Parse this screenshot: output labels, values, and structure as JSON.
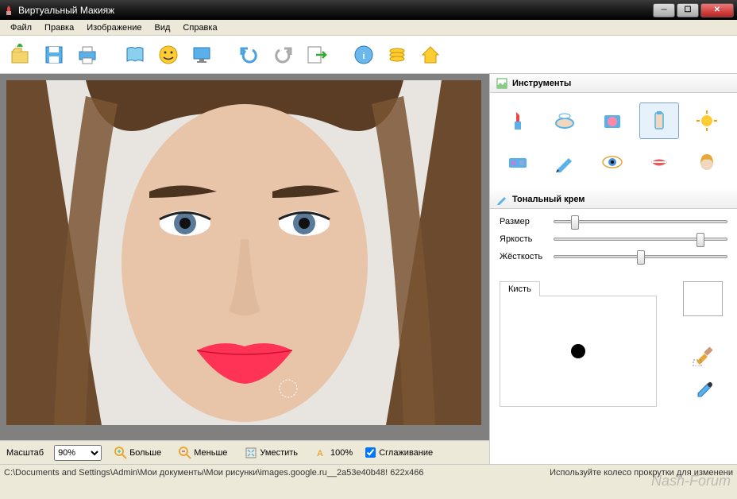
{
  "window": {
    "title": "Виртуальный Макияж"
  },
  "menu": {
    "file": "Файл",
    "edit": "Правка",
    "image": "Изображение",
    "view": "Вид",
    "help": "Справка"
  },
  "bottombar": {
    "scale_label": "Масштаб",
    "scale_value": "90%",
    "more": "Больше",
    "less": "Меньше",
    "fit": "Уместить",
    "hundred": "100%",
    "smoothing": "Сглаживание"
  },
  "panels": {
    "tools_title": "Инструменты",
    "tool_title": "Тональный крем"
  },
  "sliders": {
    "size": "Размер",
    "brightness": "Яркость",
    "hardness": "Жёсткость"
  },
  "brush": {
    "tab": "Кисть"
  },
  "status": {
    "path": "C:\\Documents and Settings\\Admin\\Мои документы\\Мои рисунки\\images.google.ru__2a53e40b48! 622x466",
    "hint": "Используйте колесо прокрутки для изменени"
  },
  "watermark": "Nash-Forum"
}
